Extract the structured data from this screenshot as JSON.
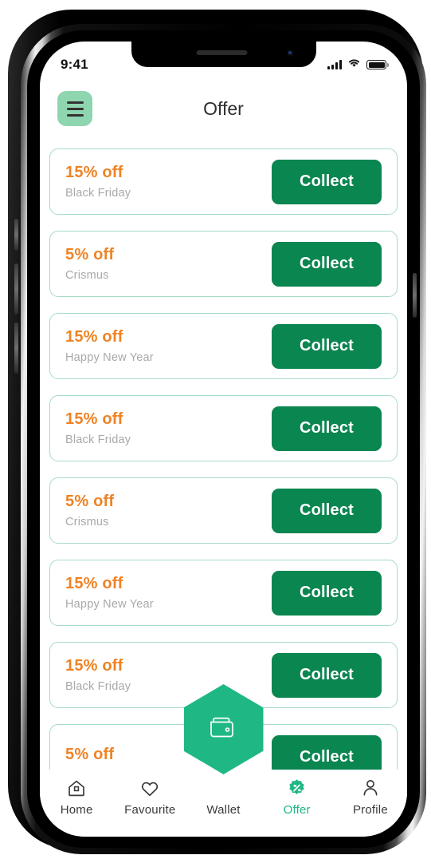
{
  "status_bar": {
    "time": "9:41",
    "signal_icon": "cellular-signal-icon",
    "wifi_icon": "wifi-icon",
    "battery_icon": "battery-full-icon"
  },
  "header": {
    "title": "Offer",
    "menu_icon": "hamburger-menu-icon"
  },
  "theme": {
    "primary_green": "#0a8650",
    "accent_green": "#1fb885",
    "mint": "#8ed6b0",
    "card_border": "#a6dcc3",
    "orange": "#ef8324",
    "muted_text": "#a9a9a9"
  },
  "offers": [
    {
      "discount": "15% off",
      "title": "Black Friday",
      "action": "Collect"
    },
    {
      "discount": "5% off",
      "title": "Crismus",
      "action": "Collect"
    },
    {
      "discount": "15% off",
      "title": "Happy New Year",
      "action": "Collect"
    },
    {
      "discount": "15% off",
      "title": "Black Friday",
      "action": "Collect"
    },
    {
      "discount": "5% off",
      "title": "Crismus",
      "action": "Collect"
    },
    {
      "discount": "15% off",
      "title": "Happy New Year",
      "action": "Collect"
    },
    {
      "discount": "15% off",
      "title": "Black Friday",
      "action": "Collect"
    },
    {
      "discount": "5% off",
      "title": "",
      "action": "Collect"
    }
  ],
  "wallet_badge": {
    "icon": "wallet-icon"
  },
  "bottom_nav": {
    "items": [
      {
        "label": "Home",
        "icon": "home-icon",
        "active": false
      },
      {
        "label": "Favourite",
        "icon": "heart-icon",
        "active": false
      },
      {
        "label": "Wallet",
        "icon": "wallet-icon",
        "active": false
      },
      {
        "label": "Offer",
        "icon": "discount-badge-icon",
        "active": true
      },
      {
        "label": "Profile",
        "icon": "person-icon",
        "active": false
      }
    ]
  }
}
